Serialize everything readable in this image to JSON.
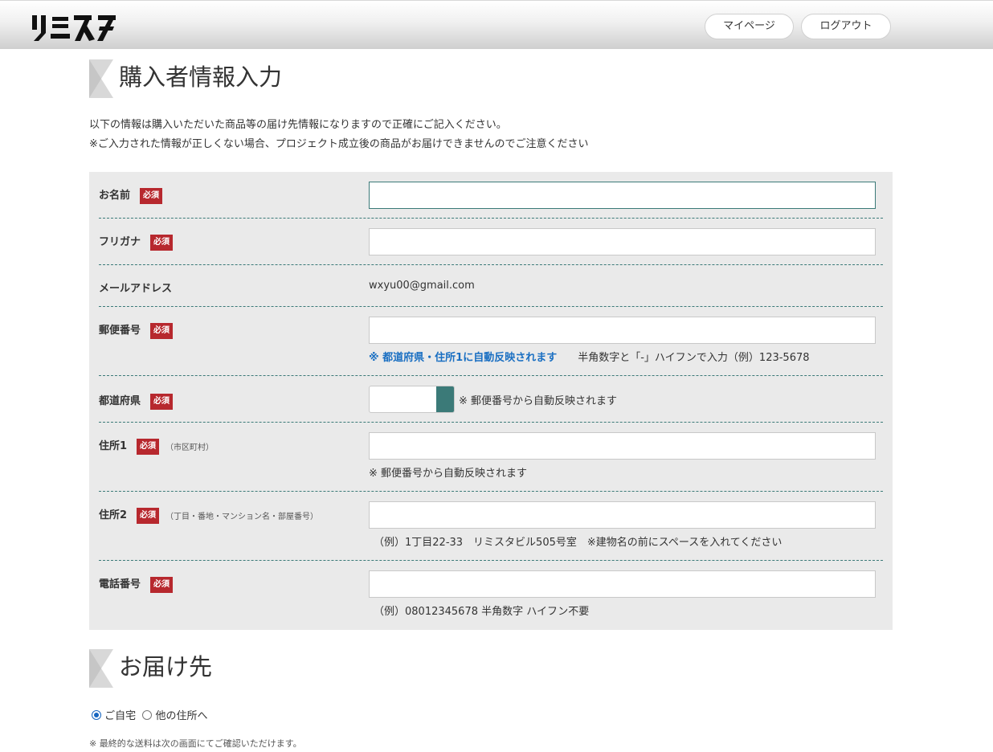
{
  "header": {
    "logo_text": "リミスタ",
    "mypage_label": "マイページ",
    "logout_label": "ログアウト"
  },
  "section1": {
    "title": "購入者情報入力",
    "intro_line1": "以下の情報は購入いただいた商品等の届け先情報になりますので正確にご記入ください。",
    "intro_line2": "※ご入力された情報が正しくない場合、プロジェクト成立後の商品がお届けできませんのでご注意ください"
  },
  "form": {
    "required_badge": "必須",
    "name": {
      "label": "お名前",
      "value": ""
    },
    "furigana": {
      "label": "フリガナ",
      "value": ""
    },
    "email": {
      "label": "メールアドレス",
      "value": "wxyu00@gmail.com"
    },
    "postal": {
      "label": "郵便番号",
      "value": "",
      "hint_blue": "※ 都道府県・住所1に自動反映されます",
      "hint_plain": "半角数字と「-」ハイフンで入力（例）123-5678"
    },
    "prefecture": {
      "label": "都道府県",
      "selected": "",
      "hint": "※ 郵便番号から自動反映されます"
    },
    "address1": {
      "label": "住所1",
      "note": "（市区町村）",
      "value": "",
      "hint": "※ 郵便番号から自動反映されます"
    },
    "address2": {
      "label": "住所2",
      "note": "（丁目・番地・マンション名・部屋番号）",
      "value": "",
      "hint": "（例）1丁目22-33　リミスタビル505号室　※建物名の前にスペースを入れてください"
    },
    "phone": {
      "label": "電話番号",
      "value": "",
      "hint": "（例）08012345678 半角数字 ハイフン不要"
    }
  },
  "section2": {
    "title": "お届け先",
    "option_home": "ご自宅",
    "option_other": "他の住所へ",
    "selected_option": "ご自宅",
    "note": "※ 最終的な送料は次の画面にてご確認いただけます。"
  }
}
